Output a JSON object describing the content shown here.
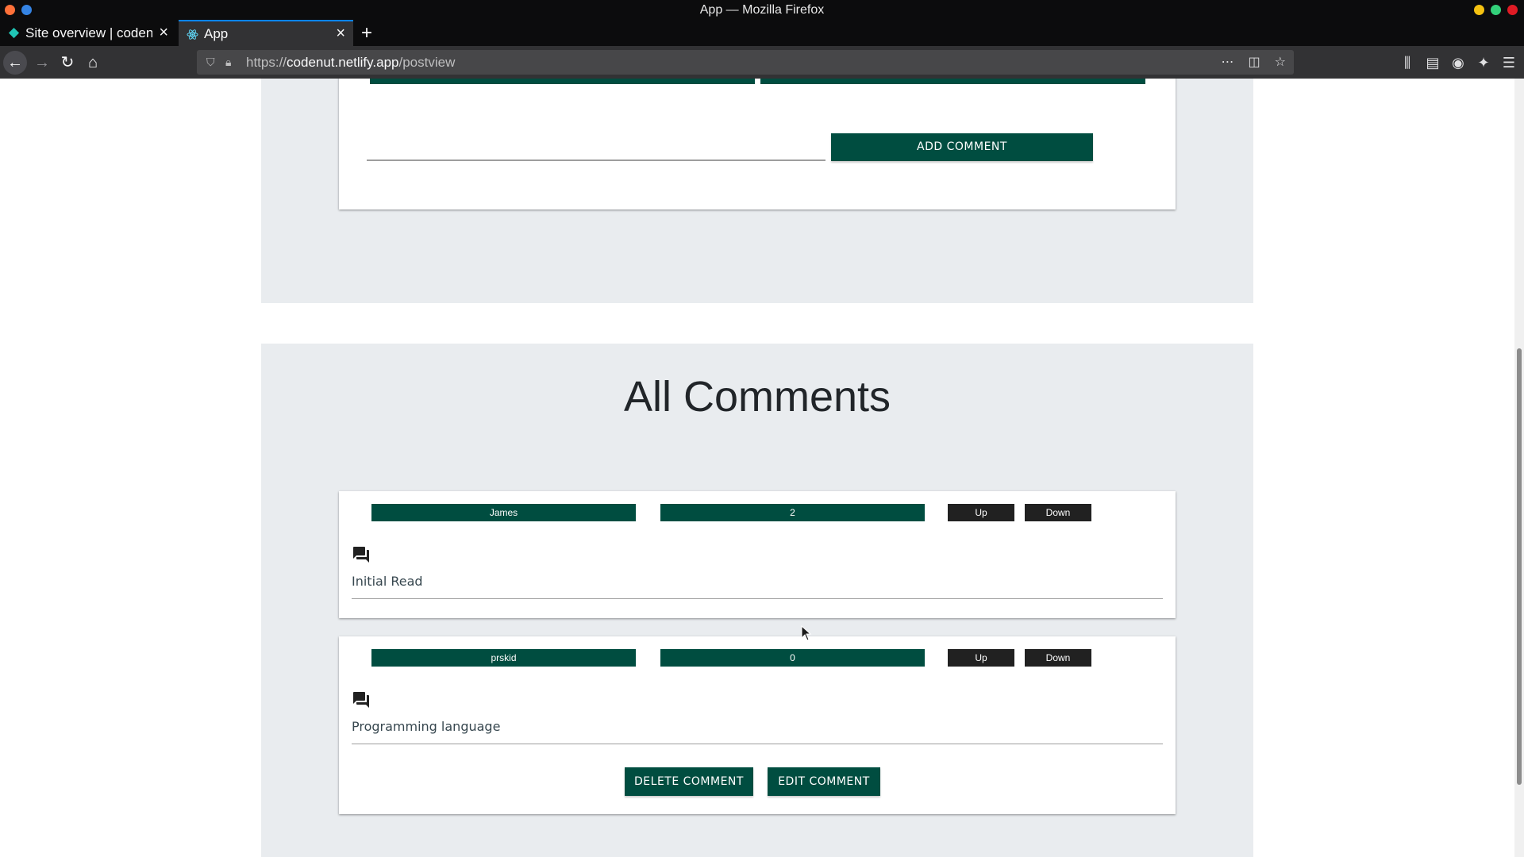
{
  "window": {
    "title": "App — Mozilla Firefox",
    "control_colors": [
      "#f5c211",
      "#33d17a",
      "#e01b24"
    ]
  },
  "tabs": [
    {
      "label": "Site overview | codenut",
      "icon": "netlify-diamond-icon",
      "active": false
    },
    {
      "label": "App",
      "icon": "react-atom-icon",
      "active": true
    }
  ],
  "navbar": {
    "url_scheme": "https://",
    "url_host": "codenut.netlify.app",
    "url_path": "/postview"
  },
  "top_section": {
    "add_comment_label": "ADD COMMENT"
  },
  "comments_section": {
    "title": "All Comments",
    "comments": [
      {
        "author": "James",
        "score": "2",
        "up_label": "Up",
        "down_label": "Down",
        "text": "Initial Read"
      },
      {
        "author": "prskid",
        "score": "0",
        "up_label": "Up",
        "down_label": "Down",
        "text": "Programming language",
        "delete_label": "DELETE COMMENT",
        "edit_label": "EDIT COMMENT"
      }
    ]
  },
  "colors": {
    "accent_green": "#004d40",
    "vote_button": "#212121",
    "section_bg": "#e9ecef"
  }
}
